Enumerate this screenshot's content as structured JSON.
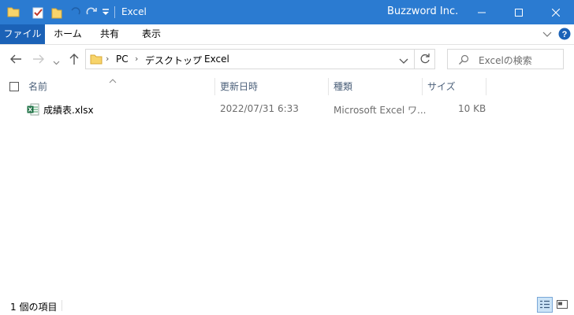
{
  "window": {
    "title": "Excel",
    "brand": "Buzzword Inc."
  },
  "ribbon": {
    "tabs": [
      {
        "label": "ファイル",
        "active": true
      },
      {
        "label": "ホーム"
      },
      {
        "label": "共有"
      },
      {
        "label": "表示"
      }
    ]
  },
  "address": {
    "crumbs": [
      "PC",
      "デスクトップ",
      "Excel"
    ],
    "search_placeholder": "Excelの検索"
  },
  "columns": {
    "name": "名前",
    "date": "更新日時",
    "type": "種類",
    "size": "サイズ"
  },
  "files": [
    {
      "name": "成績表.xlsx",
      "date": "2022/07/31 6:33",
      "type": "Microsoft Excel ワ...",
      "size": "10 KB",
      "icon": "excel-file-icon"
    }
  ],
  "status": {
    "item_count": "1 個の項目"
  },
  "colors": {
    "titlebar": "#2b7bd1",
    "file_tab": "#1b62b7",
    "header_text": "#4c607a"
  }
}
